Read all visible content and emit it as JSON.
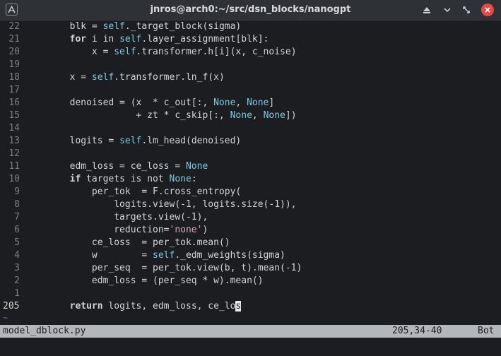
{
  "window": {
    "title": "jnros@arch0:~/src/dsn_blocks/nanogpt"
  },
  "colors": {
    "background": "#1c1d21",
    "statusline": "#b3b6bb",
    "identifier_accent": "#7ec8e3",
    "string": "#d8a8b8",
    "close_button": "#e44a4a"
  },
  "editor": {
    "lines": [
      {
        "n": "22",
        "tokens": [
          {
            "t": "        blk = "
          },
          {
            "t": "self",
            "c": "slf"
          },
          {
            "t": "._target_block(sigma)"
          }
        ]
      },
      {
        "n": "21",
        "tokens": [
          {
            "t": "        "
          },
          {
            "t": "for",
            "c": "kw"
          },
          {
            "t": " i in "
          },
          {
            "t": "self",
            "c": "slf"
          },
          {
            "t": ".layer_assignment[blk]:"
          }
        ]
      },
      {
        "n": "20",
        "tokens": [
          {
            "t": "            x = "
          },
          {
            "t": "self",
            "c": "slf"
          },
          {
            "t": ".transformer.h[i](x, c_noise)"
          }
        ]
      },
      {
        "n": "19",
        "tokens": []
      },
      {
        "n": "18",
        "tokens": [
          {
            "t": "        x = "
          },
          {
            "t": "self",
            "c": "slf"
          },
          {
            "t": ".transformer.ln_f(x)"
          }
        ]
      },
      {
        "n": "17",
        "tokens": []
      },
      {
        "n": "16",
        "tokens": [
          {
            "t": "        denoised = (x  * c_out[:, "
          },
          {
            "t": "None",
            "c": "nm"
          },
          {
            "t": ", "
          },
          {
            "t": "None",
            "c": "nm"
          },
          {
            "t": "]"
          }
        ]
      },
      {
        "n": "15",
        "tokens": [
          {
            "t": "                    + zt * c_skip[:, "
          },
          {
            "t": "None",
            "c": "nm"
          },
          {
            "t": ", "
          },
          {
            "t": "None",
            "c": "nm"
          },
          {
            "t": "])"
          }
        ]
      },
      {
        "n": "14",
        "tokens": []
      },
      {
        "n": "13",
        "tokens": [
          {
            "t": "        logits = "
          },
          {
            "t": "self",
            "c": "slf"
          },
          {
            "t": ".lm_head(denoised)"
          }
        ]
      },
      {
        "n": "12",
        "tokens": []
      },
      {
        "n": "11",
        "tokens": [
          {
            "t": "        edm_loss = ce_loss = "
          },
          {
            "t": "None",
            "c": "nm"
          }
        ]
      },
      {
        "n": "10",
        "tokens": [
          {
            "t": "        "
          },
          {
            "t": "if",
            "c": "kw"
          },
          {
            "t": " targets is not "
          },
          {
            "t": "None",
            "c": "nm"
          },
          {
            "t": ":"
          }
        ]
      },
      {
        "n": "9",
        "tokens": [
          {
            "t": "            per_tok  = F.cross_entropy("
          }
        ]
      },
      {
        "n": "8",
        "tokens": [
          {
            "t": "                logits.view(-1, logits.size(-1)),"
          }
        ]
      },
      {
        "n": "7",
        "tokens": [
          {
            "t": "                targets.view(-1),"
          }
        ]
      },
      {
        "n": "6",
        "tokens": [
          {
            "t": "                reduction="
          },
          {
            "t": "'none'",
            "c": "str"
          },
          {
            "t": ")"
          }
        ]
      },
      {
        "n": "5",
        "tokens": [
          {
            "t": "            ce_loss  = per_tok.mean()"
          }
        ]
      },
      {
        "n": "4",
        "tokens": [
          {
            "t": "            w        = "
          },
          {
            "t": "self",
            "c": "slf"
          },
          {
            "t": "._edm_weights(sigma)"
          }
        ]
      },
      {
        "n": "3",
        "tokens": [
          {
            "t": "            per_seq  = per_tok.view(b, t).mean(-1)"
          }
        ]
      },
      {
        "n": "2",
        "tokens": [
          {
            "t": "            edm_loss = (per_seq * w).mean()"
          }
        ]
      },
      {
        "n": "1",
        "tokens": []
      },
      {
        "n": "205",
        "current": true,
        "tokens": [
          {
            "t": "        "
          },
          {
            "t": "return",
            "c": "kw"
          },
          {
            "t": " logits, edm_loss, ce_lo"
          },
          {
            "t": "s",
            "c": "cursor"
          }
        ]
      }
    ],
    "tilde": "~"
  },
  "statusline": {
    "filename": "model_dblock.py",
    "position": "205,34-40",
    "scroll": "Bot"
  }
}
